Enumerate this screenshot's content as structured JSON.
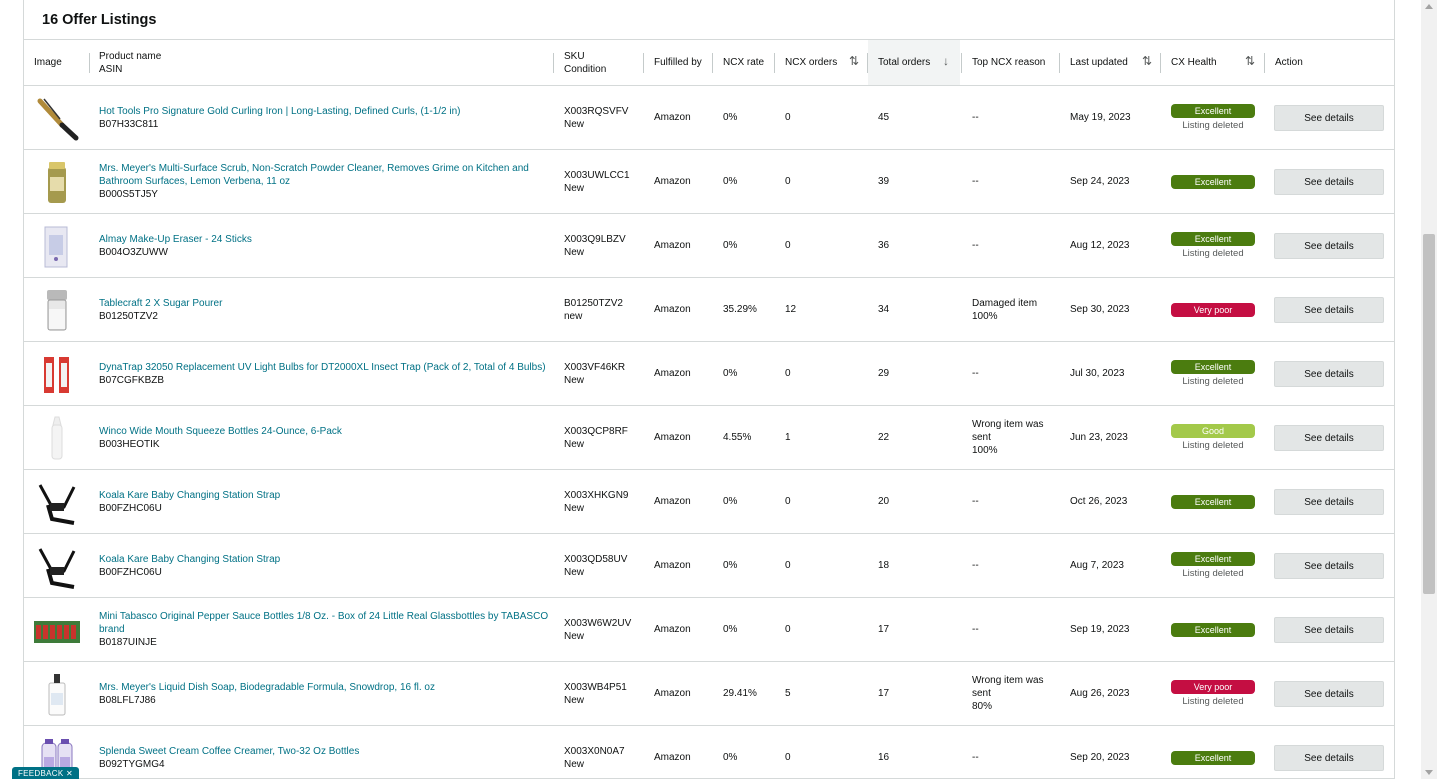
{
  "listing_title": "16 Offer Listings",
  "headers": {
    "image": "Image",
    "product_name": "Product name",
    "asin": "ASIN",
    "sku": "SKU",
    "condition": "Condition",
    "fulfilled_by": "Fulfilled by",
    "ncx_rate": "NCX rate",
    "ncx_orders": "NCX orders",
    "total_orders": "Total orders",
    "top_ncx_reason": "Top NCX reason",
    "last_updated": "Last updated",
    "cx_health": "CX Health",
    "action": "Action"
  },
  "sort_icons": {
    "updown": "⇅",
    "down": "↓"
  },
  "colors": {
    "excellent": "#4b7c0f",
    "very_poor": "#c40e42",
    "good": "#a3c94a",
    "link": "#007185"
  },
  "rows": [
    {
      "icon": "curling-iron-thumbnail-icon",
      "name": "Hot Tools Pro Signature Gold Curling Iron | Long-Lasting, Defined Curls, (1-1/2 in)",
      "asin": "B07H33C811",
      "sku": "X003RQSVFV",
      "condition": "New",
      "fulfilled": "Amazon",
      "ncx_rate": "0%",
      "ncx_orders": "0",
      "total_orders": "45",
      "reason": "--",
      "reason_pct": "",
      "updated": "May 19, 2023",
      "health": "Excellent",
      "health_key": "excellent",
      "health_sub": "Listing deleted",
      "action": "See details"
    },
    {
      "icon": "scrub-bottle-thumbnail-icon",
      "name": "Mrs. Meyer's Multi-Surface Scrub, Non-Scratch Powder Cleaner, Removes Grime on Kitchen and Bathroom Surfaces, Lemon Verbena, 11 oz",
      "asin": "B000S5TJ5Y",
      "sku": "X003UWLCC1",
      "condition": "New",
      "fulfilled": "Amazon",
      "ncx_rate": "0%",
      "ncx_orders": "0",
      "total_orders": "39",
      "reason": "--",
      "reason_pct": "",
      "updated": "Sep 24, 2023",
      "health": "Excellent",
      "health_key": "excellent",
      "health_sub": "",
      "action": "See details"
    },
    {
      "icon": "eraser-box-thumbnail-icon",
      "name": "Almay Make-Up Eraser - 24 Sticks",
      "asin": "B004O3ZUWW",
      "sku": "X003Q9LBZV",
      "condition": "New",
      "fulfilled": "Amazon",
      "ncx_rate": "0%",
      "ncx_orders": "0",
      "total_orders": "36",
      "reason": "--",
      "reason_pct": "",
      "updated": "Aug 12, 2023",
      "health": "Excellent",
      "health_key": "excellent",
      "health_sub": "Listing deleted",
      "action": "See details"
    },
    {
      "icon": "sugar-pourer-thumbnail-icon",
      "name": "Tablecraft 2 X Sugar Pourer",
      "asin": "B01250TZV2",
      "sku": "B01250TZV2",
      "condition": "new",
      "fulfilled": "Amazon",
      "ncx_rate": "35.29%",
      "ncx_orders": "12",
      "total_orders": "34",
      "reason": "Damaged item",
      "reason_pct": "100%",
      "updated": "Sep 30, 2023",
      "health": "Very poor",
      "health_key": "very_poor",
      "health_sub": "",
      "action": "See details"
    },
    {
      "icon": "uv-bulbs-thumbnail-icon",
      "name": "DynaTrap 32050 Replacement UV Light Bulbs for DT2000XL Insect Trap (Pack of 2, Total of 4 Bulbs)",
      "asin": "B07CGFKBZB",
      "sku": "X003VF46KR",
      "condition": "New",
      "fulfilled": "Amazon",
      "ncx_rate": "0%",
      "ncx_orders": "0",
      "total_orders": "29",
      "reason": "--",
      "reason_pct": "",
      "updated": "Jul 30, 2023",
      "health": "Excellent",
      "health_key": "excellent",
      "health_sub": "Listing deleted",
      "action": "See details"
    },
    {
      "icon": "squeeze-bottle-thumbnail-icon",
      "name": "Winco Wide Mouth Squeeze Bottles 24-Ounce, 6-Pack",
      "asin": "B003HEOTIK",
      "sku": "X003QCP8RF",
      "condition": "New",
      "fulfilled": "Amazon",
      "ncx_rate": "4.55%",
      "ncx_orders": "1",
      "total_orders": "22",
      "reason": "Wrong item was sent",
      "reason_pct": "100%",
      "updated": "Jun 23, 2023",
      "health": "Good",
      "health_key": "good",
      "health_sub": "Listing deleted",
      "action": "See details"
    },
    {
      "icon": "strap-thumbnail-icon",
      "name": "Koala Kare Baby Changing Station Strap",
      "asin": "B00FZHC06U",
      "sku": "X003XHKGN9",
      "condition": "New",
      "fulfilled": "Amazon",
      "ncx_rate": "0%",
      "ncx_orders": "0",
      "total_orders": "20",
      "reason": "--",
      "reason_pct": "",
      "updated": "Oct 26, 2023",
      "health": "Excellent",
      "health_key": "excellent",
      "health_sub": "",
      "action": "See details"
    },
    {
      "icon": "strap-thumbnail-icon",
      "name": "Koala Kare Baby Changing Station Strap",
      "asin": "B00FZHC06U",
      "sku": "X003QD58UV",
      "condition": "New",
      "fulfilled": "Amazon",
      "ncx_rate": "0%",
      "ncx_orders": "0",
      "total_orders": "18",
      "reason": "--",
      "reason_pct": "",
      "updated": "Aug 7, 2023",
      "health": "Excellent",
      "health_key": "excellent",
      "health_sub": "Listing deleted",
      "action": "See details"
    },
    {
      "icon": "tabasco-bottles-thumbnail-icon",
      "name": "Mini Tabasco Original Pepper Sauce Bottles 1/8 Oz. - Box of 24 Little Real Glassbottles by TABASCO brand",
      "asin": "B0187UINJE",
      "sku": "X003W6W2UV",
      "condition": "New",
      "fulfilled": "Amazon",
      "ncx_rate": "0%",
      "ncx_orders": "0",
      "total_orders": "17",
      "reason": "--",
      "reason_pct": "",
      "updated": "Sep 19, 2023",
      "health": "Excellent",
      "health_key": "excellent",
      "health_sub": "",
      "action": "See details"
    },
    {
      "icon": "dish-soap-thumbnail-icon",
      "name": "Mrs. Meyer's Liquid Dish Soap, Biodegradable Formula, Snowdrop, 16 fl. oz",
      "asin": "B08LFL7J86",
      "sku": "X003WB4P51",
      "condition": "New",
      "fulfilled": "Amazon",
      "ncx_rate": "29.41%",
      "ncx_orders": "5",
      "total_orders": "17",
      "reason": "Wrong item was sent",
      "reason_pct": "80%",
      "updated": "Aug 26, 2023",
      "health": "Very poor",
      "health_key": "very_poor",
      "health_sub": "Listing deleted",
      "action": "See details"
    },
    {
      "icon": "creamer-bottles-thumbnail-icon",
      "name": "Splenda Sweet Cream Coffee Creamer, Two-32 Oz Bottles",
      "asin": "B092TYGMG4",
      "sku": "X003X0N0A7",
      "condition": "New",
      "fulfilled": "Amazon",
      "ncx_rate": "0%",
      "ncx_orders": "0",
      "total_orders": "16",
      "reason": "--",
      "reason_pct": "",
      "updated": "Sep 20, 2023",
      "health": "Excellent",
      "health_key": "excellent",
      "health_sub": "",
      "action": "See details"
    }
  ],
  "feedback_label": "FEEDBACK ✕"
}
